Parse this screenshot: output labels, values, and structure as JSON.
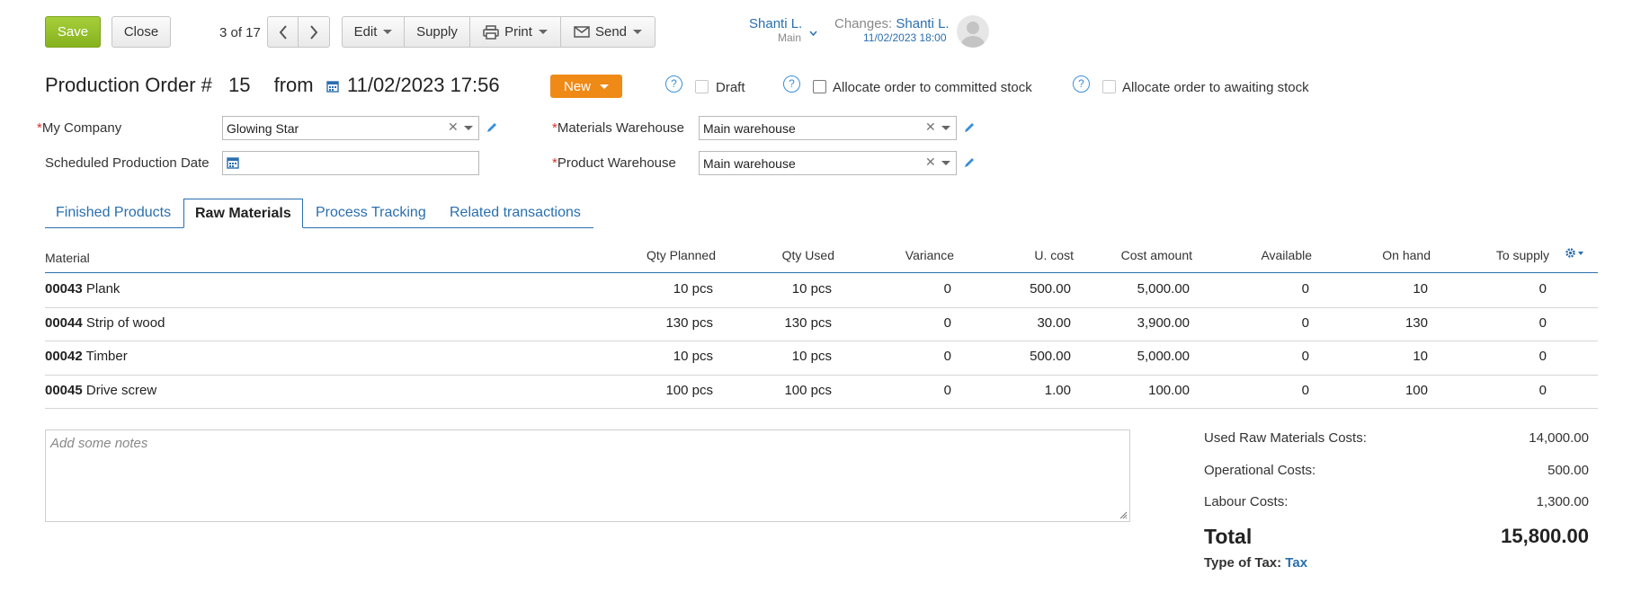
{
  "toolbar": {
    "save_label": "Save",
    "close_label": "Close",
    "pager_text": "3 of 17",
    "edit_label": "Edit",
    "supply_label": "Supply",
    "print_label": "Print",
    "send_label": "Send"
  },
  "user": {
    "name": "Shanti L.",
    "context": "Main",
    "changes_label": "Changes:",
    "changes_user": "Shanti L.",
    "changes_time": "11/02/2023 18:00"
  },
  "order": {
    "title_prefix": "Production Order #",
    "number": "15",
    "from_label": "from",
    "datetime": "11/02/2023 17:56",
    "status_label": "New",
    "draft_label": "Draft",
    "committed_label": "Allocate order to committed stock",
    "awaiting_label": "Allocate order to awaiting stock"
  },
  "form": {
    "company_label": "My Company",
    "company_value": "Glowing Star",
    "scheduled_label": "Scheduled Production Date",
    "scheduled_value": "",
    "materials_wh_label": "Materials Warehouse",
    "materials_wh_value": "Main warehouse",
    "product_wh_label": "Product Warehouse",
    "product_wh_value": "Main warehouse",
    "required_mark": "*"
  },
  "tabs": [
    {
      "label": "Finished Products",
      "active": false
    },
    {
      "label": "Raw Materials",
      "active": true
    },
    {
      "label": "Process Tracking",
      "active": false
    },
    {
      "label": "Related transactions",
      "active": false
    }
  ],
  "table": {
    "headers": [
      "Material",
      "Qty Planned",
      "Qty Used",
      "Variance",
      "U. cost",
      "Cost amount",
      "Available",
      "On hand",
      "To supply"
    ],
    "rows": [
      {
        "code": "00043",
        "name": "Plank",
        "qty_planned": "10 pcs",
        "qty_used": "10 pcs",
        "variance": "0",
        "u_cost": "500.00",
        "cost_amount": "5,000.00",
        "available": "0",
        "on_hand": "10",
        "to_supply": "0"
      },
      {
        "code": "00044",
        "name": "Strip of wood",
        "qty_planned": "130 pcs",
        "qty_used": "130 pcs",
        "variance": "0",
        "u_cost": "30.00",
        "cost_amount": "3,900.00",
        "available": "0",
        "on_hand": "130",
        "to_supply": "0"
      },
      {
        "code": "00042",
        "name": "Timber",
        "qty_planned": "10 pcs",
        "qty_used": "10 pcs",
        "variance": "0",
        "u_cost": "500.00",
        "cost_amount": "5,000.00",
        "available": "0",
        "on_hand": "10",
        "to_supply": "0"
      },
      {
        "code": "00045",
        "name": "Drive screw",
        "qty_planned": "100 pcs",
        "qty_used": "100 pcs",
        "variance": "0",
        "u_cost": "1.00",
        "cost_amount": "100.00",
        "available": "0",
        "on_hand": "100",
        "to_supply": "0"
      }
    ]
  },
  "notes": {
    "placeholder": "Add some notes"
  },
  "summary": {
    "raw_label": "Used Raw Materials Costs:",
    "raw_value": "14,000.00",
    "op_label": "Operational Costs:",
    "op_value": "500.00",
    "labour_label": "Labour Costs:",
    "labour_value": "1,300.00",
    "total_label": "Total",
    "total_value": "15,800.00",
    "tax_label": "Type of Tax:",
    "tax_value": "Tax"
  },
  "colors": {
    "save": "#8ebb22",
    "status": "#ef8a17",
    "link": "#2a6fae"
  }
}
